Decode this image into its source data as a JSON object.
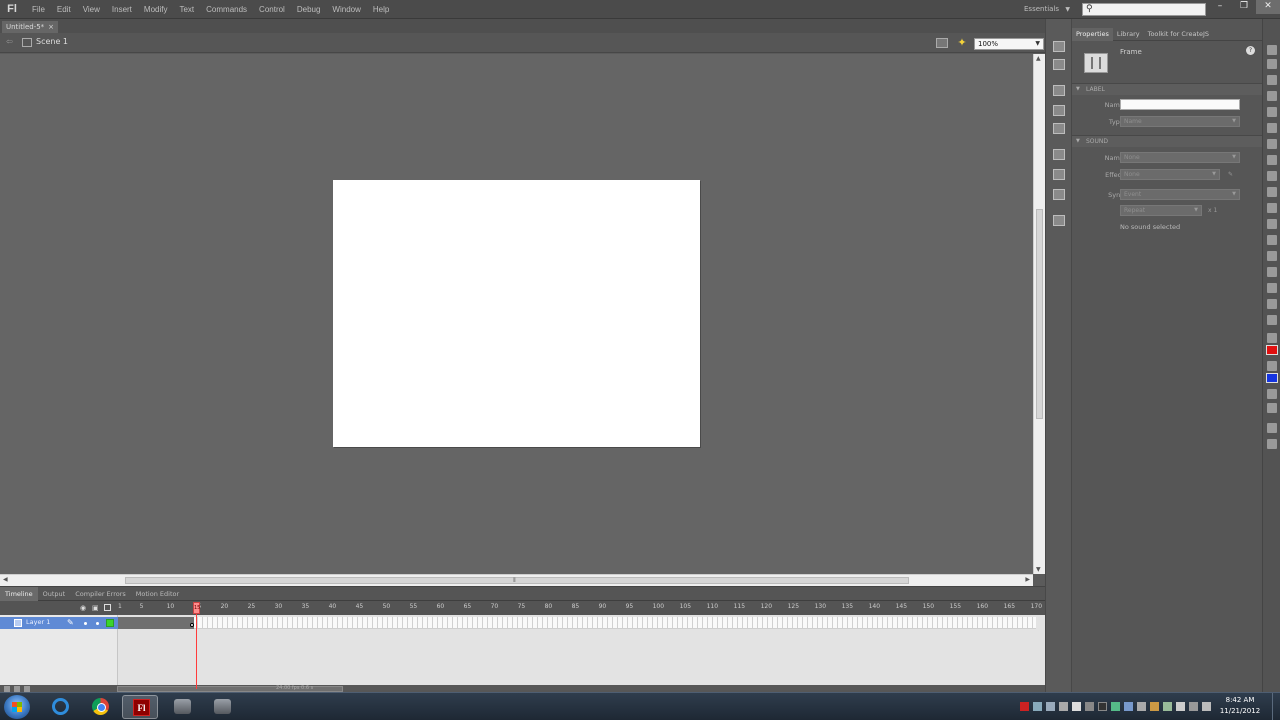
{
  "app": {
    "logo": "Fl",
    "menus": [
      "File",
      "Edit",
      "View",
      "Insert",
      "Modify",
      "Text",
      "Commands",
      "Control",
      "Debug",
      "Window",
      "Help"
    ],
    "workspace": "Essentials",
    "help_search_value": ""
  },
  "document": {
    "tab_title": "Untitled-5*",
    "scene": "Scene 1",
    "zoom": "100%"
  },
  "properties_panel": {
    "tabs": [
      "Properties",
      "Library",
      "Toolkit for CreateJS"
    ],
    "frame_type": "Frame",
    "label_section": "LABEL",
    "name_label": "Name:",
    "name_value": "",
    "type_label": "Type:",
    "type_value": "Name",
    "sound_section": "SOUND",
    "sound_name_label": "Name:",
    "sound_name_value": "None",
    "effect_label": "Effect:",
    "effect_value": "None",
    "sync_label": "Sync:",
    "sync_value": "Event",
    "repeat_value": "Repeat",
    "repeat_count": "x 1",
    "no_sound_note": "No sound selected"
  },
  "timeline": {
    "tabs": [
      "Timeline",
      "Output",
      "Compiler Errors",
      "Motion Editor"
    ],
    "ruler": [
      "1",
      "5",
      "10",
      "15",
      "20",
      "25",
      "30",
      "35",
      "40",
      "45",
      "50",
      "55",
      "60",
      "65",
      "70",
      "75",
      "80",
      "85",
      "90",
      "95",
      "100",
      "105",
      "110",
      "115",
      "120",
      "125",
      "130",
      "135",
      "140",
      "145",
      "150",
      "155",
      "160",
      "165",
      "170"
    ],
    "layer_name": "Layer 1",
    "fps": "24.00 fps",
    "time": "0.6 s",
    "current_frame": "15"
  },
  "taskbar": {
    "time": "8:42 AM",
    "date": "11/21/2012"
  },
  "colors": {
    "stroke": "#e01010",
    "fill": "#1434e0",
    "layer_highlight": "#5f8ad5",
    "playhead": "#ff3b3b"
  },
  "icons": [
    "back-arrow-icon",
    "scene-icon",
    "edit-symbols-icon",
    "edit-scene-icon",
    "search-icon",
    "minimize-icon",
    "maximize-icon",
    "close-icon",
    "help-icon",
    "pencil-icon",
    "layer-icon",
    "start-icon",
    "ie-icon",
    "chrome-icon",
    "flash-icon"
  ]
}
